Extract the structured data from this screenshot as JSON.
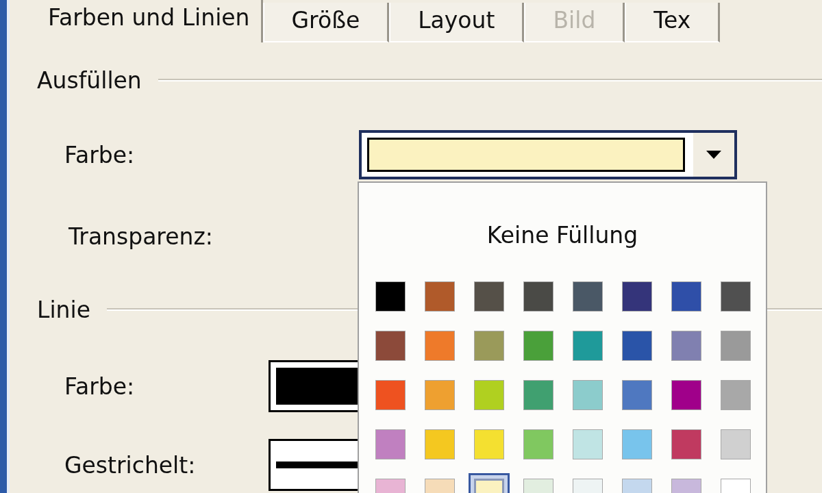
{
  "tabs": [
    {
      "label": "Farben und Linien",
      "selected": true,
      "disabled": false
    },
    {
      "label": "Größe",
      "selected": false,
      "disabled": false
    },
    {
      "label": "Layout",
      "selected": false,
      "disabled": false
    },
    {
      "label": "Bild",
      "selected": false,
      "disabled": true
    },
    {
      "label": "Tex",
      "selected": false,
      "disabled": false
    }
  ],
  "fill_section": {
    "title": "Ausfüllen",
    "color": {
      "label": "Farbe:"
    },
    "transparency": {
      "label": "Transparenz:"
    }
  },
  "line_section": {
    "title": "Linie",
    "color": {
      "label": "Farbe:"
    },
    "dashed": {
      "label": "Gestrichelt:"
    }
  },
  "color_popup": {
    "no_fill_label": "Keine Füllung",
    "swatches": [
      {
        "color": "#000000",
        "selected": false
      },
      {
        "color": "#b05a2a",
        "selected": false
      },
      {
        "color": "#555048",
        "selected": false
      },
      {
        "color": "#4a4a46",
        "selected": false
      },
      {
        "color": "#4a5866",
        "selected": false
      },
      {
        "color": "#34347a",
        "selected": false
      },
      {
        "color": "#2f4fa8",
        "selected": false
      },
      {
        "color": "#505050",
        "selected": false
      },
      {
        "color": "#8c4a3a",
        "selected": false
      },
      {
        "color": "#ee7a2a",
        "selected": false
      },
      {
        "color": "#9a9a5a",
        "selected": false
      },
      {
        "color": "#4aa03a",
        "selected": false
      },
      {
        "color": "#1f9a9a",
        "selected": false
      },
      {
        "color": "#2a54a8",
        "selected": false
      },
      {
        "color": "#8080b0",
        "selected": false
      },
      {
        "color": "#9a9a9a",
        "selected": false
      },
      {
        "color": "#ee5220",
        "selected": false
      },
      {
        "color": "#eea030",
        "selected": false
      },
      {
        "color": "#b0d020",
        "selected": false
      },
      {
        "color": "#40a070",
        "selected": false
      },
      {
        "color": "#8ccccc",
        "selected": false
      },
      {
        "color": "#4f78c0",
        "selected": false
      },
      {
        "color": "#a0008a",
        "selected": false
      },
      {
        "color": "#a8a8a8",
        "selected": false
      },
      {
        "color": "#c080c0",
        "selected": false
      },
      {
        "color": "#f4c820",
        "selected": false
      },
      {
        "color": "#f4e030",
        "selected": false
      },
      {
        "color": "#80c860",
        "selected": false
      },
      {
        "color": "#c0e4e4",
        "selected": false
      },
      {
        "color": "#78c4ec",
        "selected": false
      },
      {
        "color": "#c03a60",
        "selected": false
      },
      {
        "color": "#d0d0d0",
        "selected": false
      },
      {
        "color": "#e8b4d4",
        "selected": false
      },
      {
        "color": "#f6dcb8",
        "selected": false
      },
      {
        "color": "#fbf2c0",
        "selected": true
      },
      {
        "color": "#e2eee0",
        "selected": false
      },
      {
        "color": "#eef4f4",
        "selected": false
      },
      {
        "color": "#c4d8ee",
        "selected": false
      },
      {
        "color": "#c8b8dc",
        "selected": false
      },
      {
        "color": "#ffffff",
        "selected": false
      }
    ]
  }
}
